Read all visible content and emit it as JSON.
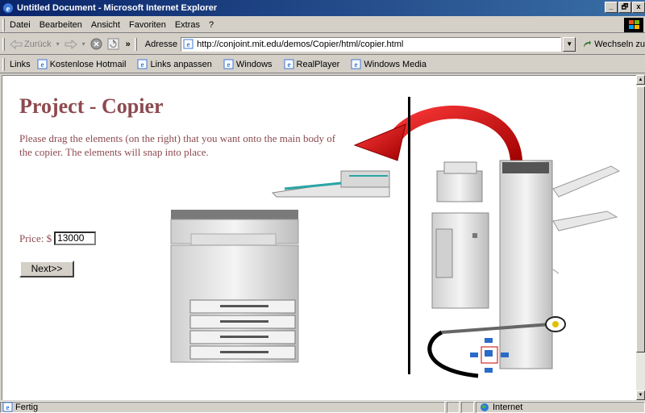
{
  "window": {
    "title": "Untitled Document - Microsoft Internet Explorer",
    "controls": [
      "_",
      "🗗",
      "x"
    ]
  },
  "menubar": {
    "items": [
      "Datei",
      "Bearbeiten",
      "Ansicht",
      "Favoriten",
      "Extras",
      "?"
    ]
  },
  "toolbar": {
    "back_label": "Zurück",
    "address_label": "Adresse",
    "url": "http://conjoint.mit.edu/demos/Copier/html/copier.html",
    "go_label": "Wechseln zu"
  },
  "linksbar": {
    "label": "Links",
    "items": [
      "Kostenlose Hotmail",
      "Links anpassen",
      "Windows",
      "RealPlayer",
      "Windows Media"
    ]
  },
  "page": {
    "title": "Project - Copier",
    "instructions": "Please drag the elements (on the right) that you want onto the main body of the copier. The elements will snap into place.",
    "price_label": "Price: $",
    "price_value": "13000",
    "next_label": "Next>>"
  },
  "statusbar": {
    "status": "Fertig",
    "zone": "Internet"
  },
  "colors": {
    "title_bar": "#0a246a",
    "page_text": "#8c4a50",
    "arrow": "#e00000",
    "chrome": "#d4d0c8"
  },
  "icons": [
    "ie-icon",
    "back-arrow-icon",
    "forward-arrow-icon",
    "stop-icon",
    "refresh-icon",
    "page-icon",
    "go-arrow-icon",
    "windows-logo-icon",
    "globe-icon"
  ]
}
